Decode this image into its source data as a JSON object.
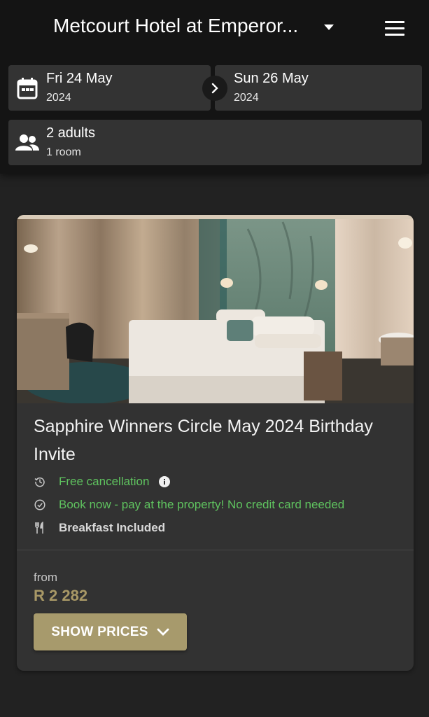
{
  "header": {
    "hotel_name": "Metcourt Hotel at Emperor...",
    "dropdown_icon": "caret-down-icon",
    "menu_icon": "hamburger-menu-icon"
  },
  "dates": {
    "checkin_day": "Fri 24 May",
    "checkin_year": "2024",
    "checkout_day": "Sun 26 May",
    "checkout_year": "2024",
    "calendar_icon": "calendar-icon",
    "arrow_icon": "chevron-right-icon"
  },
  "guests": {
    "adults": "2 adults",
    "rooms": "1 room",
    "icon": "people-icon"
  },
  "rate": {
    "title": "Sapphire Winners Circle May 2024 Birthday Invite",
    "features": [
      {
        "icon": "history-icon",
        "label": "Free cancellation"
      },
      {
        "icon": "check-circle-icon",
        "label": "Book now - pay at the property! No credit card needed"
      },
      {
        "icon": "restaurant-icon",
        "label": "Breakfast Included"
      }
    ],
    "from_label": "from",
    "price": "R 2 282",
    "button_label": "SHOW PRICES"
  },
  "colors": {
    "background": "#222222",
    "header": "#141414",
    "card": "#323232",
    "green": "#5fc35f",
    "gold": "#a79a6c"
  }
}
